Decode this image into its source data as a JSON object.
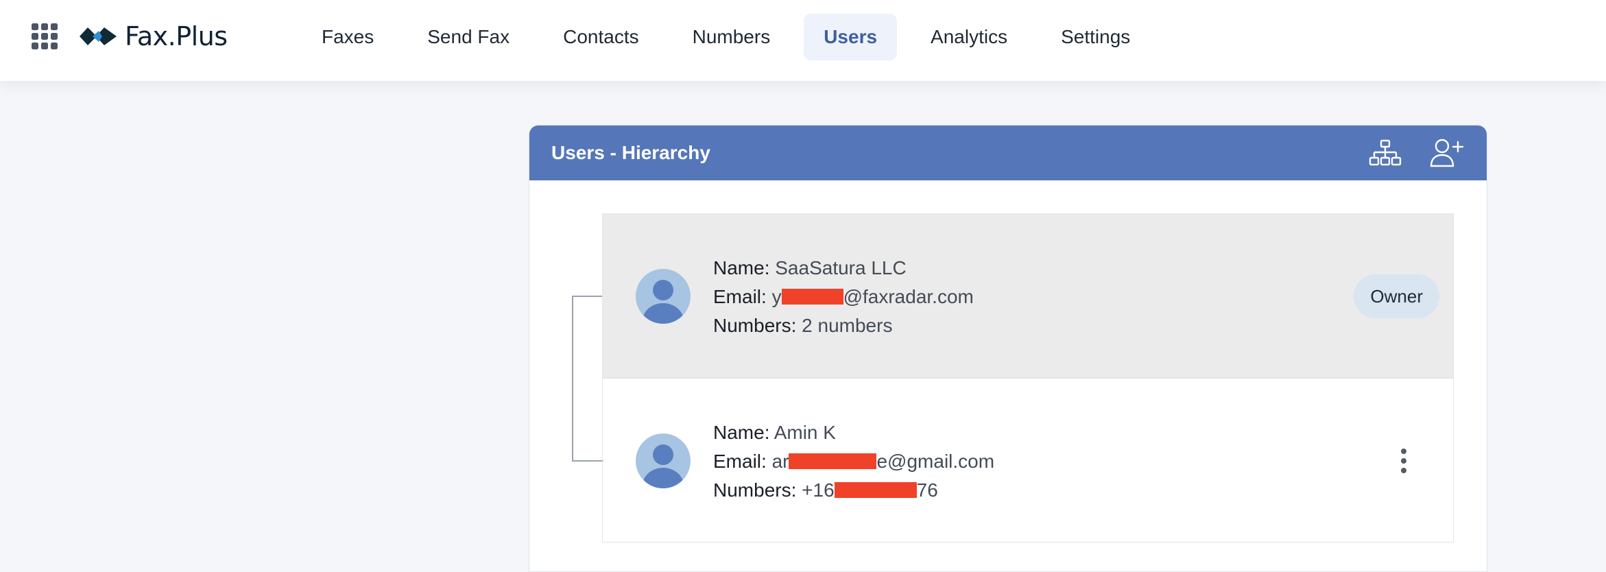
{
  "brand": {
    "name": "Fax.Plus"
  },
  "nav": {
    "items": [
      {
        "label": "Faxes",
        "active": false
      },
      {
        "label": "Send Fax",
        "active": false
      },
      {
        "label": "Contacts",
        "active": false
      },
      {
        "label": "Numbers",
        "active": false
      },
      {
        "label": "Users",
        "active": true
      },
      {
        "label": "Analytics",
        "active": false
      },
      {
        "label": "Settings",
        "active": false
      }
    ]
  },
  "card": {
    "title": "Users - Hierarchy",
    "actions": {
      "hierarchy_icon": "hierarchy-icon",
      "add_user_icon": "add-user-icon"
    }
  },
  "labels": {
    "name": "Name:",
    "email": "Email:",
    "numbers": "Numbers:"
  },
  "users": [
    {
      "name": "SaaSatura LLC",
      "email_prefix": "y",
      "email_suffix": "@faxradar.com",
      "numbers_prefix": "2 numbers",
      "numbers_suffix": "",
      "badge": "Owner"
    },
    {
      "name": "Amin K",
      "email_prefix": "ar",
      "email_suffix": "e@gmail.com",
      "numbers_prefix": "+16",
      "numbers_suffix": "76",
      "badge": ""
    }
  ],
  "colors": {
    "header": "#5576b9",
    "redaction": "#ef4229",
    "active_nav": "#3e5f9f",
    "owner_badge": "#d9e5f1"
  }
}
